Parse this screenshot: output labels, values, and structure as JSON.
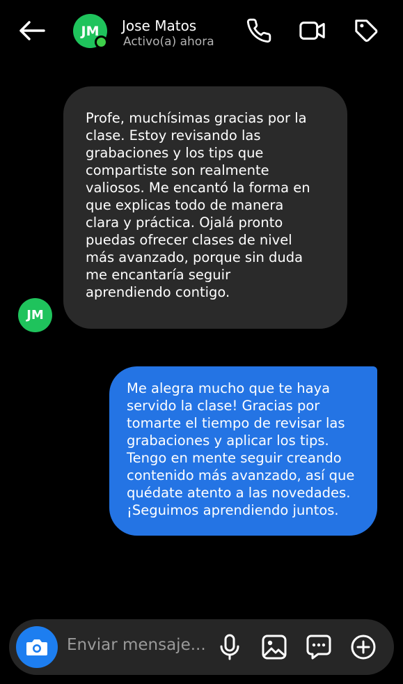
{
  "header": {
    "avatar_initials": "JM",
    "contact_name": "Jose Matos",
    "status": "Activo(a) ahora",
    "icons": [
      "back-arrow-icon",
      "phone-icon",
      "video-camera-icon",
      "tag-icon"
    ]
  },
  "messages": [
    {
      "direction": "incoming",
      "avatar_initials": "JM",
      "text": "Profe, muchísimas gracias por la\nclase. Estoy revisando las\ngrabaciones y los tips que\ncompartiste son realmente\nvaliosos. Me encantó la forma en\nque explicas todo de manera\nclara y práctica. Ojalá pronto\npuedas ofrecer clases de nivel\nmás avanzado, porque sin duda\nme encantaría seguir\naprendiendo contigo."
    },
    {
      "direction": "outgoing",
      "text": "Me alegra mucho que te haya\nservido la clase! Gracias por\ntomarte el tiempo de revisar las\ngrabaciones y aplicar los tips.\nTengo en mente seguir creando\ncontenido más avanzado, así que\nquédate atento a las novedades.\n¡Seguimos aprendiendo juntos."
    }
  ],
  "composer": {
    "placeholder": "Enviar mensaje...",
    "icons": [
      "camera-icon",
      "microphone-icon",
      "image-icon",
      "sticker-chat-icon",
      "plus-circle-icon"
    ]
  },
  "colors": {
    "background": "#000000",
    "incoming_bubble": "#2a2a2a",
    "outgoing_bubble": "#2474e4",
    "avatar": "#1fc35c",
    "online_dot": "#3ecf4a",
    "camera_button": "#1d7ef0",
    "composer_bg": "#262626"
  }
}
